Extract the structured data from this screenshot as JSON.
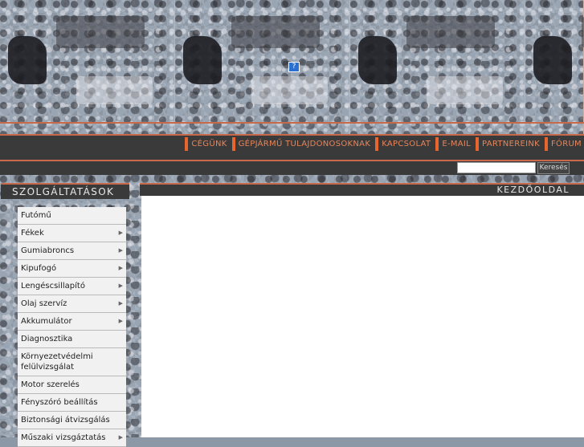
{
  "banner": {
    "help_label": "?"
  },
  "nav": {
    "items": [
      {
        "label": "CÉGÜNK"
      },
      {
        "label": "GÉPJÁRMŰ TULAJDONOSOKNAK"
      },
      {
        "label": "KAPCSOLAT"
      },
      {
        "label": "E-MAIL"
      },
      {
        "label": "PARTNEREINK"
      },
      {
        "label": "FÓRUM"
      }
    ]
  },
  "search": {
    "value": "",
    "button_label": "Keresés"
  },
  "sidebar": {
    "title": "SZOLGÁLTATÁSOK",
    "items": [
      {
        "label": "Futómű",
        "has_submenu": false
      },
      {
        "label": "Fékek",
        "has_submenu": true
      },
      {
        "label": "Gumiabroncs",
        "has_submenu": true
      },
      {
        "label": "Kipufogó",
        "has_submenu": true
      },
      {
        "label": "Lengéscsillapító",
        "has_submenu": true
      },
      {
        "label": "Olaj szervíz",
        "has_submenu": true
      },
      {
        "label": "Akkumulátor",
        "has_submenu": true
      },
      {
        "label": "Diagnosztika",
        "has_submenu": false
      },
      {
        "label": "Környezetvédelmi felülvizsgálat",
        "has_submenu": false
      },
      {
        "label": "Motor szerelés",
        "has_submenu": false
      },
      {
        "label": "Fényszóró beállítás",
        "has_submenu": false
      },
      {
        "label": "Biztonsági átvizsgálás",
        "has_submenu": false
      },
      {
        "label": "Műszaki vizsgáztatás",
        "has_submenu": true
      }
    ],
    "arrow_glyph": "▶"
  },
  "main": {
    "title": "KEZDŐOLDAL"
  },
  "colors": {
    "accent": "#e8652e",
    "bar": "#3a3a3a",
    "stripe": "#c86a4a"
  }
}
